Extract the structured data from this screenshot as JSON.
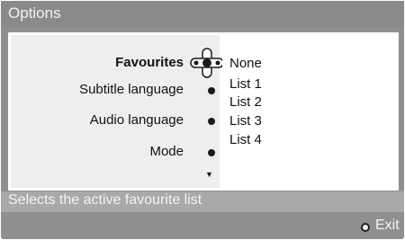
{
  "window": {
    "title": "Options"
  },
  "menu": {
    "items": [
      {
        "label": "Favourites",
        "selected": true
      },
      {
        "label": "Subtitle language",
        "selected": false
      },
      {
        "label": "Audio language",
        "selected": false
      },
      {
        "label": "Mode",
        "selected": false
      }
    ]
  },
  "submenu": {
    "options": [
      "None",
      "List 1",
      "List 2",
      "List 3",
      "List 4"
    ],
    "highlighted": "None"
  },
  "status": {
    "text": "Selects the active favourite list"
  },
  "footer": {
    "exit_label": "Exit"
  },
  "icons": {
    "nav": "navigation-cross-icon",
    "bullet": "bullet-icon",
    "more": "down-arrow-icon",
    "exit": "exit-button-icon"
  },
  "colors": {
    "frame": "#8f8f8f",
    "title_bar": "#8a8a8a",
    "status_bar": "#a9a9a9",
    "left_pane": "#eeeeee",
    "text_light": "#f4f4f4",
    "text_dark": "#111111"
  }
}
